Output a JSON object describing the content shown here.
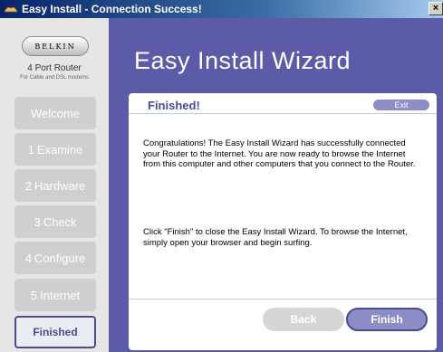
{
  "window": {
    "title": "Easy Install - Connection Success!",
    "close_glyph": "×"
  },
  "sidebar": {
    "brand": "BELKIN",
    "product": "4 Port Router",
    "product_sub": "For Cable and DSL modems",
    "steps": [
      {
        "num": "",
        "label": "Welcome",
        "state": "disabled"
      },
      {
        "num": "1",
        "label": "Examine",
        "state": "disabled"
      },
      {
        "num": "2",
        "label": "Hardware",
        "state": "disabled"
      },
      {
        "num": "3",
        "label": "Check",
        "state": "disabled"
      },
      {
        "num": "4",
        "label": "Configure",
        "state": "disabled"
      },
      {
        "num": "5",
        "label": "Internet",
        "state": "disabled"
      },
      {
        "num": "",
        "label": "Finished",
        "state": "active"
      }
    ]
  },
  "main": {
    "title": "Easy Install Wizard",
    "panel": {
      "title": "Finished!",
      "exit_label": "Exit",
      "paragraph1": "Congratulations! The Easy Install Wizard has successfully connected your Router to the Internet. You are now ready to browse the Internet from this computer and other computers that you connect to the Router.",
      "paragraph2": "Click \"Finish\" to close the Easy Install Wizard. To browse the Internet, simply open your browser and begin surfing."
    },
    "buttons": {
      "back": "Back",
      "finish": "Finish"
    }
  },
  "colors": {
    "accent": "#5b5ba8",
    "accent_dark": "#4b4b8f",
    "button_light": "#8d8dc6",
    "disabled": "#cfcfcf"
  }
}
